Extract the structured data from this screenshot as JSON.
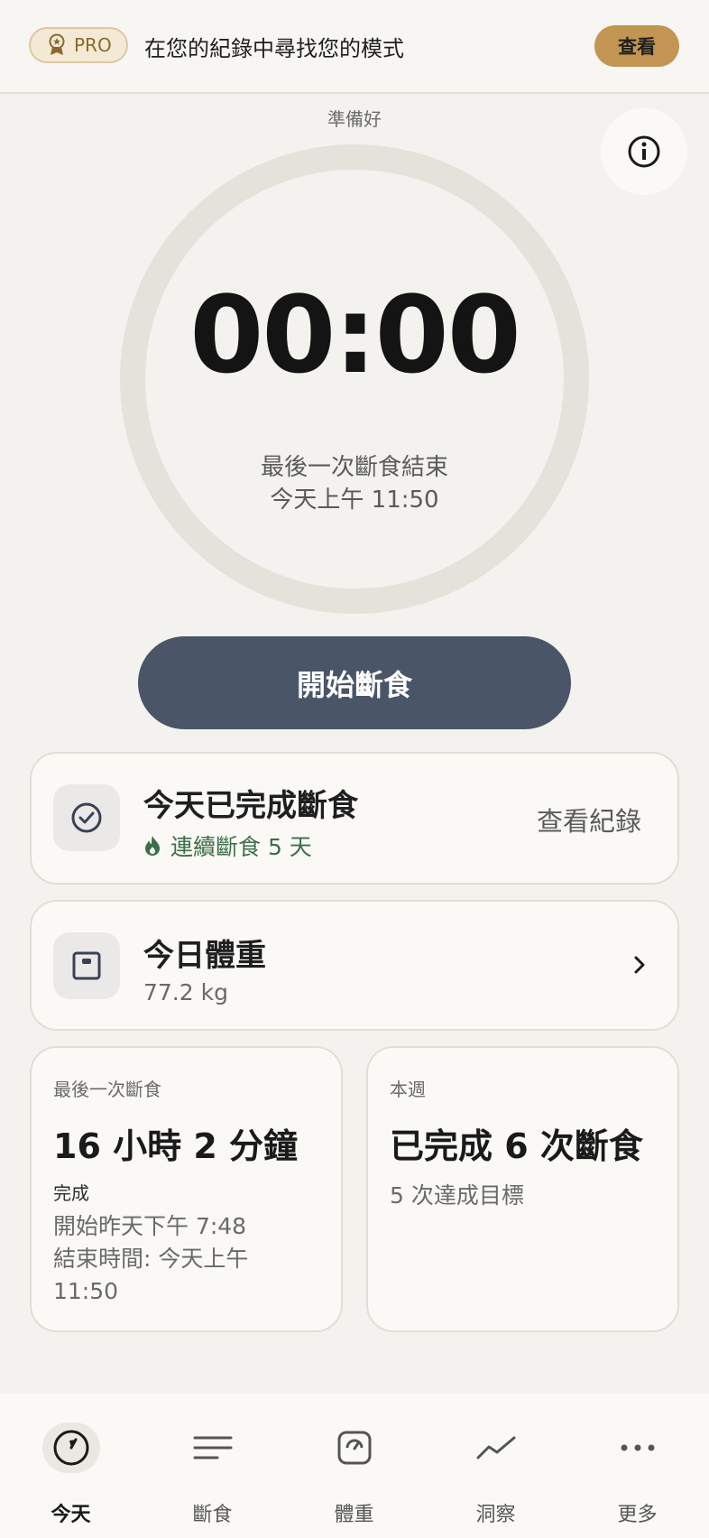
{
  "banner": {
    "pro_label": "PRO",
    "text": "在您的紀錄中尋找您的模式",
    "view_button": "查看"
  },
  "timer": {
    "state": "準備好",
    "value": "00:00",
    "last_fast_label": "最後一次斷食結束",
    "last_fast_time": "今天上午 11:50",
    "progress": 0
  },
  "start_button": "開始斷食",
  "today_card": {
    "title": "今天已完成斷食",
    "streak": "連續斷食 5 天",
    "link": "查看紀錄"
  },
  "weight_card": {
    "title": "今日體重",
    "value": "77.2 kg"
  },
  "last_fast_card": {
    "label": "最後一次斷食",
    "duration": "16 小時 2 分鐘",
    "status": "完成",
    "start": "開始昨天下午 7:48",
    "end_line1": "結束時間: 今天上午",
    "end_line2": "11:50"
  },
  "week_card": {
    "label": "本週",
    "completed": "已完成 6 次斷食",
    "goal": "5 次達成目標"
  },
  "nav": {
    "today": "今天",
    "fasting": "斷食",
    "weight": "體重",
    "insights": "洞察",
    "more": "更多"
  },
  "colors": {
    "accent_gold": "#c29553",
    "start_button": "#4a5568",
    "streak_green": "#3d6e4a",
    "ring": "#e5e2db"
  }
}
